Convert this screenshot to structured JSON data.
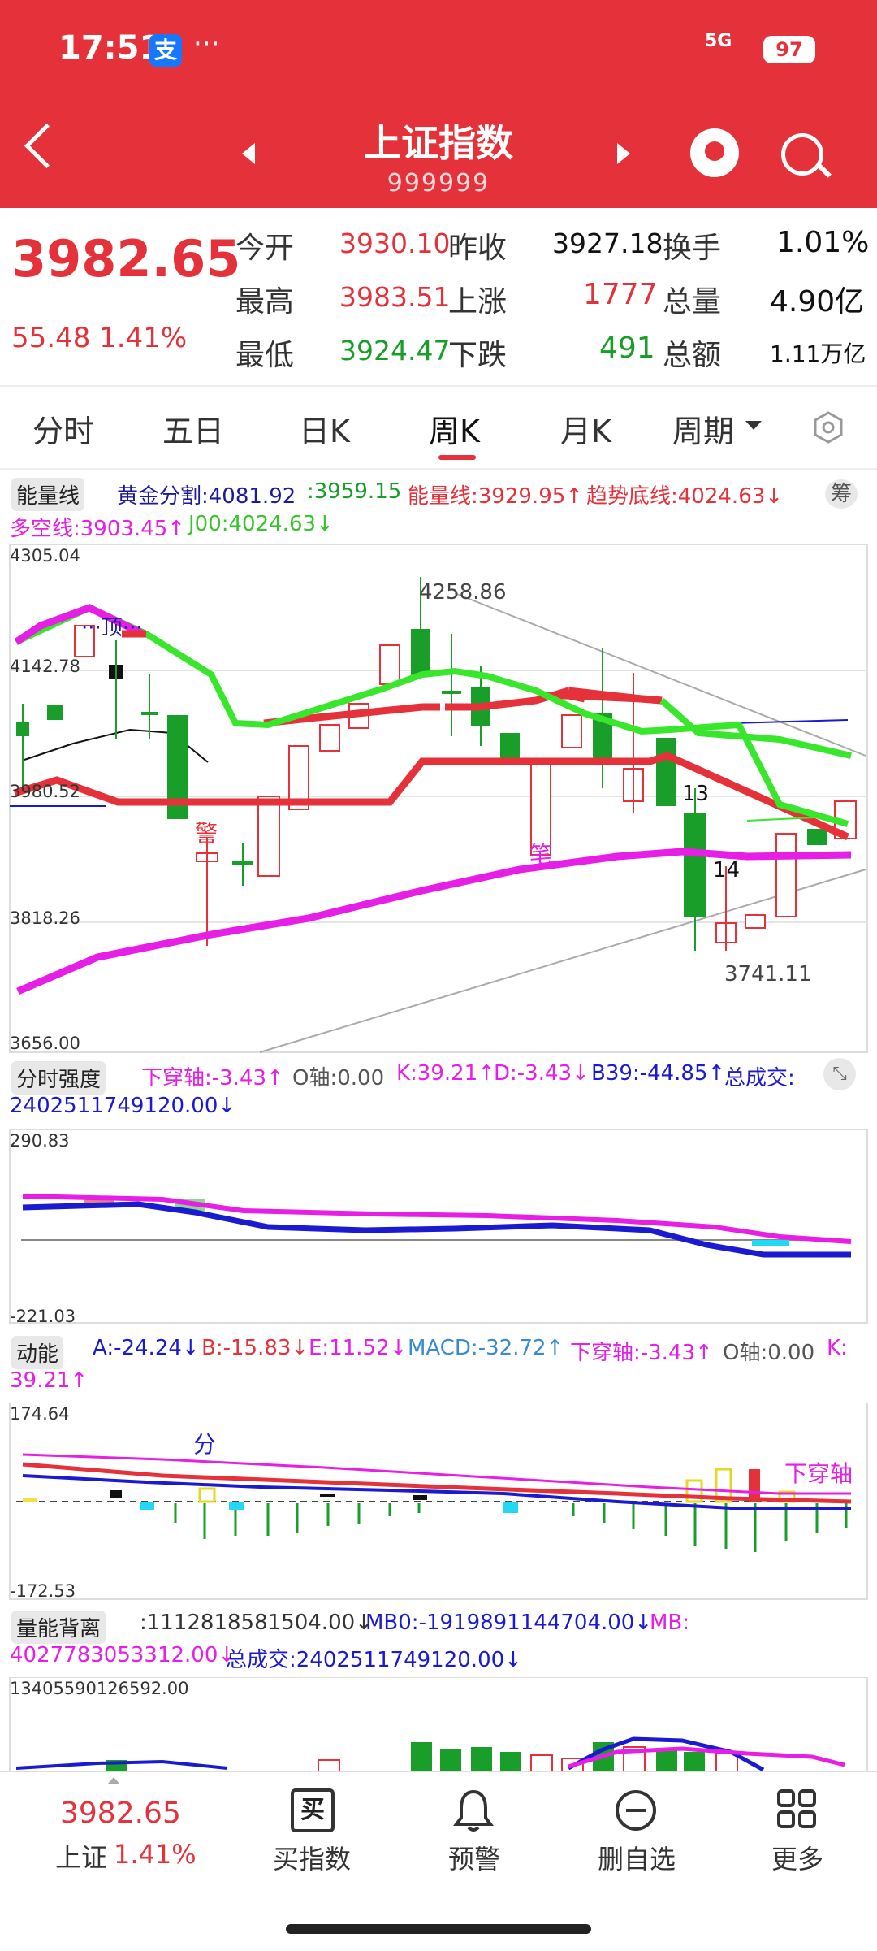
{
  "status": {
    "time": "17:51",
    "alipay": "支",
    "more": "···",
    "network": "5G",
    "battery": "97"
  },
  "header": {
    "title": "上证指数",
    "code": "999999"
  },
  "quote": {
    "price": "3982.65",
    "change": "55.48 1.41%",
    "open_label": "今开",
    "open": "3930.10",
    "prev_label": "昨收",
    "prev": "3927.18",
    "turnover_label": "换手",
    "turnover": "1.01%",
    "high_label": "最高",
    "high": "3983.51",
    "up_label": "上涨",
    "up": "1777",
    "volume_label": "总量",
    "volume": "4.90亿",
    "low_label": "最低",
    "low": "3924.47",
    "down_label": "下跌",
    "down": "491",
    "amount_label": "总额",
    "amount": "1.11万亿"
  },
  "tabs": [
    "分时",
    "五日",
    "日K",
    "周K",
    "月K",
    "周期"
  ],
  "main_panel": {
    "selector": "能量线",
    "gold": "黄金分割:4081.92",
    "gold2": ":3959.15",
    "energy": "能量线:3929.95↑",
    "trend": "趋势底线:4024.63↓",
    "bullbear": "多空线:3903.45↑",
    "j00": "J00:4024.63↓",
    "chip_btn": "筹",
    "y_top": "4305.04",
    "y_2": "4142.78",
    "y_3": "3980.52",
    "y_4": "3818.26",
    "y_bottom": "3656.00",
    "ann_top": "顶",
    "ann_high": "4258.86",
    "ann_low": "3741.11",
    "ann_13": "13",
    "ann_14": "14",
    "ann_warn": "警",
    "ann_bi": "笔"
  },
  "panel2": {
    "selector": "分时强度",
    "l1": "下穿轴:-3.43↑",
    "l2": "O轴:0.00",
    "l3": "K:39.21↑",
    "l4": "D:-3.43↓",
    "l5": "B39:-44.85↑",
    "l6": "总成交:",
    "l7": "2402511749120.00↓",
    "y_top": "290.83",
    "y_bottom": "-221.03"
  },
  "panel3": {
    "selector": "动能",
    "a": "A:-24.24↓",
    "b": "B:-15.83↓",
    "e": "E:11.52↓",
    "macd": "MACD:-32.72↑",
    "cross": "下穿轴:-3.43↑",
    "o": "O轴:0.00",
    "k": "K:",
    "k2": "39.21↑",
    "y_top": "174.64",
    "y_bottom": "-172.53",
    "ann_fen": "分",
    "ann_cross": "下穿轴"
  },
  "panel4": {
    "selector": "量能背离",
    "v1": ":1112818581504.00↓",
    "mb0": "MB0:-1919891144704.00↓",
    "mb": "MB:",
    "v2": "4027783053312.00↓",
    "total": "总成交:2402511749120.00↓",
    "y_top": "13405590126592.00"
  },
  "bottom_bar": {
    "price": "3982.65",
    "name": "上证",
    "pct": "1.41%",
    "buy": "买指数",
    "buy_icon": "买",
    "alert": "预警",
    "delete": "删自选",
    "more": "更多"
  },
  "colors": {
    "red": "#e5323a",
    "green": "#1a9e2a",
    "magenta": "#e61ee6",
    "bright_green": "#38e62c",
    "blue": "#1a1ad0"
  }
}
